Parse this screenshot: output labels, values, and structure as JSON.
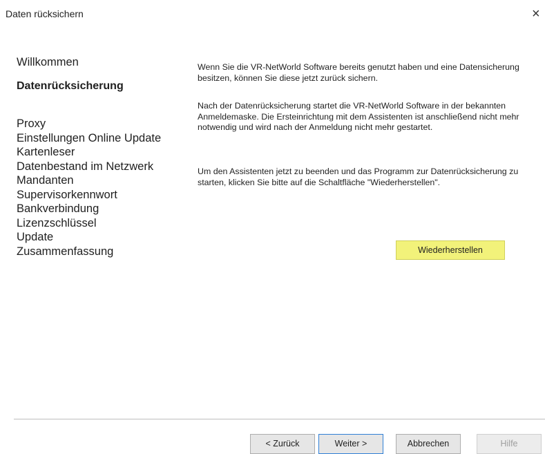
{
  "window": {
    "title": "Daten rücksichern",
    "close_glyph": "×"
  },
  "sidebar": {
    "items": [
      {
        "label": "Willkommen"
      },
      {
        "label": "Datenrücksicherung"
      },
      {
        "label": "Proxy"
      },
      {
        "label": "Einstellungen Online Update"
      },
      {
        "label": "Kartenleser"
      },
      {
        "label": "Datenbestand im Netzwerk"
      },
      {
        "label": "Mandanten"
      },
      {
        "label": "Supervisorkennwort"
      },
      {
        "label": "Bankverbindung"
      },
      {
        "label": "Lizenzschlüssel"
      },
      {
        "label": "Update"
      },
      {
        "label": "Zusammenfassung"
      }
    ]
  },
  "main": {
    "paragraph1": "Wenn Sie die VR-NetWorld Software bereits genutzt haben und eine Datensicherung besitzen, können Sie diese jetzt zurück sichern.",
    "paragraph2": "Nach der Datenrücksicherung startet die VR-NetWorld Software in der bekannten Anmeldemaske. Die Ersteinrichtung mit dem Assistenten ist anschließend nicht mehr notwendig und wird nach der Anmeldung nicht mehr gestartet.",
    "paragraph3": "Um den Assistenten jetzt zu beenden und das Programm zur Datenrücksicherung zu starten, klicken Sie bitte auf die Schaltfläche \"Wiederherstellen\".",
    "restore_label": "Wiederherstellen",
    "restore_color": "#f2f27a"
  },
  "footer": {
    "back_label": "< Zurück",
    "next_label": "Weiter >",
    "cancel_label": "Abbrechen",
    "help_label": "Hilfe"
  }
}
